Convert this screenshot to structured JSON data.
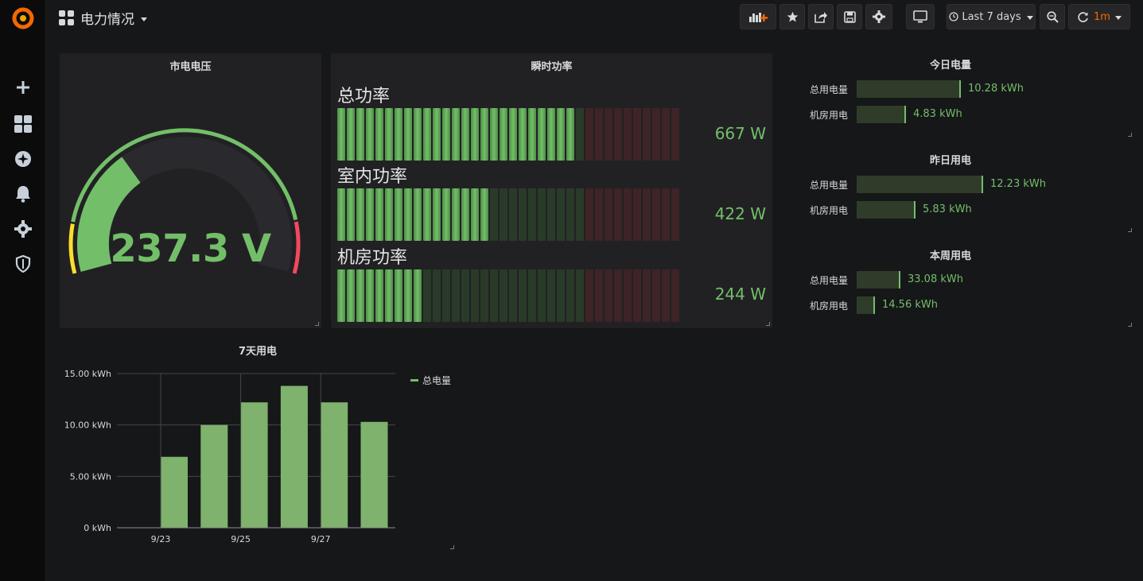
{
  "header": {
    "title": "电力情况",
    "time_range": "Last 7 days",
    "refresh": "1m"
  },
  "colors": {
    "green": "#73bf69",
    "yellow": "#fade2a",
    "red": "#f2495c",
    "orange": "#f46800"
  },
  "sidebar": {
    "items": [
      "plus-icon",
      "dashboards-icon",
      "explore-icon",
      "alerting-icon",
      "configuration-icon",
      "shield-icon"
    ]
  },
  "gauge": {
    "title": "市电电压",
    "value": "237.3 V",
    "fraction": 0.33
  },
  "power": {
    "title": "瞬时功率",
    "rows": [
      {
        "label": "总功率",
        "value": "667 W",
        "lit": 25
      },
      {
        "label": "室内功率",
        "value": "422 W",
        "lit": 16
      },
      {
        "label": "机房功率",
        "value": "244 W",
        "lit": 9
      }
    ],
    "total_cells": 36,
    "green_cells": 26
  },
  "energy_sections": [
    {
      "title": "今日电量",
      "rows": [
        {
          "label": "总用电量",
          "value": "10.28 kWh",
          "fraction": 0.57
        },
        {
          "label": "机房用电",
          "value": "4.83 kWh",
          "fraction": 0.27
        }
      ]
    },
    {
      "title": "昨日用电",
      "rows": [
        {
          "label": "总用电量",
          "value": "12.23 kWh",
          "fraction": 0.69
        },
        {
          "label": "机房用电",
          "value": "5.83 kWh",
          "fraction": 0.32
        }
      ]
    },
    {
      "title": "本周用电",
      "rows": [
        {
          "label": "总用电量",
          "value": "33.08 kWh",
          "fraction": 0.24
        },
        {
          "label": "机房用电",
          "value": "14.56 kWh",
          "fraction": 0.1
        }
      ]
    }
  ],
  "chart_title": "7天用电",
  "chart_data": {
    "type": "bar",
    "title": "7天用电",
    "x_ticks": [
      "9/23",
      "9/25",
      "9/27"
    ],
    "y_ticks": [
      "0 kWh",
      "5.00 kWh",
      "10.00 kWh",
      "15.00 kWh"
    ],
    "ylim": [
      0,
      15
    ],
    "series": [
      {
        "name": "总电量",
        "values": [
          6.9,
          10.0,
          12.2,
          13.8,
          12.2,
          10.3
        ]
      }
    ],
    "grid": true,
    "legend": "right"
  }
}
